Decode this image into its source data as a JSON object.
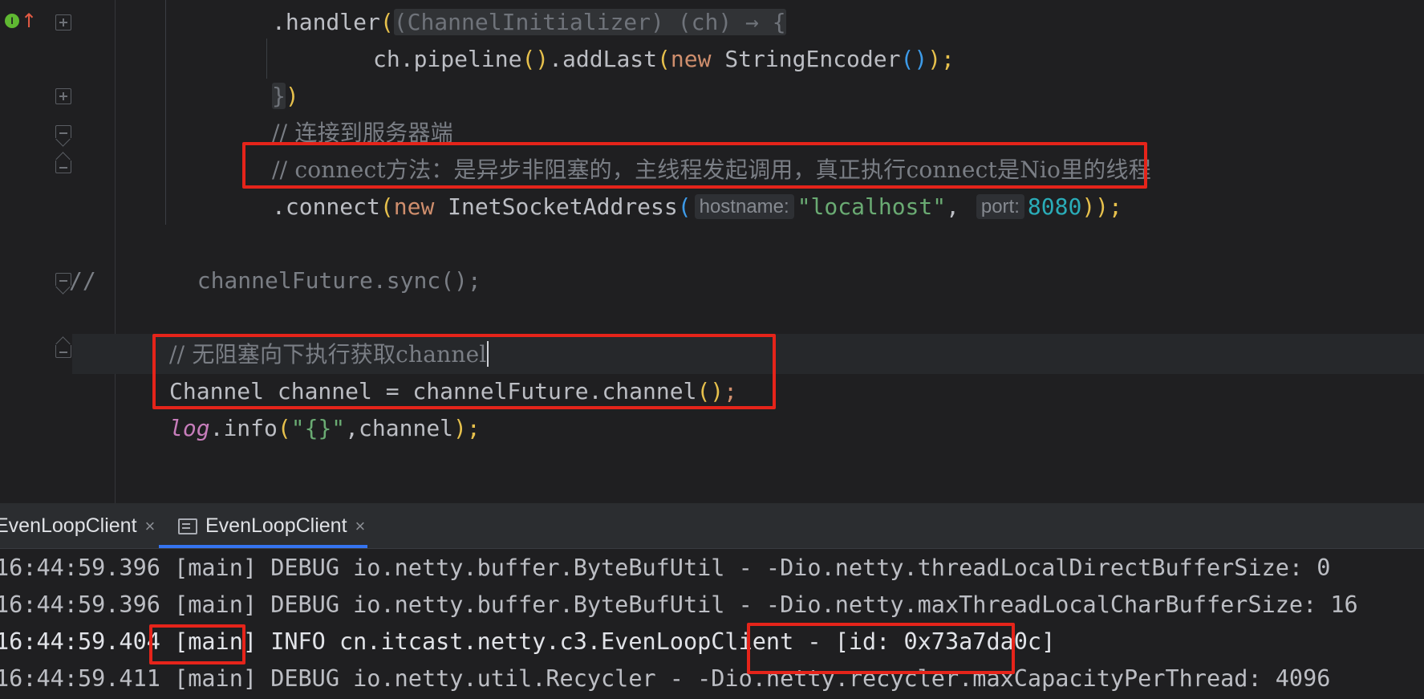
{
  "editor": {
    "lines": {
      "handler": {
        "dot": ".",
        "method": "handler",
        "open": "(",
        "cast": "(ChannelInitializer) (ch) → {"
      },
      "pipeline": {
        "obj": "ch.",
        "m1": "pipeline",
        "p1": "()",
        "dot": ".",
        "m2": "addLast",
        "open": "(",
        "kw": "new",
        "cls": "StringEncoder",
        "p2": "()",
        "close": ");"
      },
      "close_brace": {
        "brace": "}",
        "paren": ")"
      },
      "comment1": "// 连接到服务器端",
      "comment2": "// connect方法：是异步非阻塞的，主线程发起调用，真正执行connect是Nio里的线程",
      "connect": {
        "dot": ".",
        "method": "connect",
        "open": "(",
        "kw": "new",
        "cls": "InetSocketAddress",
        "open2": "(",
        "hint_host": "hostname:",
        "host": "\"localhost\"",
        "comma": ",",
        "hint_port": "port:",
        "port": "8080",
        "close": "));"
      },
      "commented_sync": {
        "prefix": "//",
        "code": "channelFuture.sync();"
      },
      "comment3": "// 无阻塞向下执行获取channel",
      "channel_decl": {
        "text": "Channel channel = channelFuture.",
        "method": "channel",
        "parens": "()",
        "semi": ";"
      },
      "log": {
        "field": "log",
        "dot": ".",
        "method": "info",
        "open": "(",
        "str": "\"{}\"",
        "rest": ",channel",
        "close": ");"
      }
    }
  },
  "run_panel": {
    "tabs": [
      {
        "label": "EvenLoopClient",
        "close": "×"
      },
      {
        "label": "EvenLoopClient",
        "close": "×",
        "active": true
      }
    ]
  },
  "console": {
    "lines": [
      {
        "time": "16:44:59.396",
        "thread": "[main]",
        "rest": "DEBUG io.netty.buffer.ByteBufUtil - -Dio.netty.threadLocalDirectBufferSize: 0"
      },
      {
        "time": "16:44:59.396",
        "thread": "[main]",
        "rest": "DEBUG io.netty.buffer.ByteBufUtil - -Dio.netty.maxThreadLocalCharBufferSize: 16"
      },
      {
        "time": "16:44:59.404",
        "thread": "[main]",
        "rest": "INFO cn.itcast.netty.c3.EvenLoopClient - [id: 0x73a7da0c]"
      },
      {
        "time": "16:44:59.411",
        "thread": "[main]",
        "rest": "DEBUG io.netty.util.Recycler - -Dio.netty.recycler.maxCapacityPerThread: 4096"
      }
    ]
  },
  "colors": {
    "highlight_box": "#e5241a",
    "tab_active_underline": "#3574f0",
    "comment": "#7a7e85",
    "keyword": "#cf8e6d",
    "string": "#6aab73",
    "number": "#2aacb8",
    "method": "#56a8f5"
  }
}
